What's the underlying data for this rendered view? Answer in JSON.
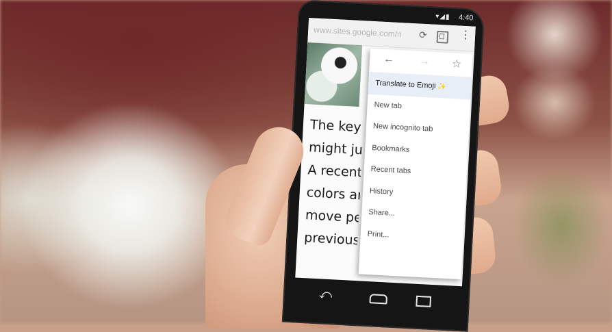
{
  "status_bar": {
    "time": "4:40",
    "icons": "▾◢▮"
  },
  "browser": {
    "url": "www.sites.google.com/n",
    "reload_icon": "reload-icon",
    "tabs_icon": "tabs-icon",
    "menu_icon": "overflow-menu-icon"
  },
  "article_lines": [
    "The key",
    "might jus",
    "A recent",
    "colors an",
    "move pe",
    "previous"
  ],
  "menu": {
    "nav_icons": {
      "back": "←",
      "forward": "→",
      "star": "☆"
    },
    "items": [
      {
        "label": "Translate to Emoji",
        "accent": "✨",
        "highlighted": true
      },
      {
        "label": "New tab"
      },
      {
        "label": "New incognito tab"
      },
      {
        "label": "Bookmarks"
      },
      {
        "label": "Recent tabs"
      },
      {
        "label": "History"
      },
      {
        "label": "Share..."
      },
      {
        "label": "Print..."
      }
    ]
  },
  "system_nav": {
    "back": "⤺",
    "home": "home-icon",
    "recents": "recents-icon"
  }
}
